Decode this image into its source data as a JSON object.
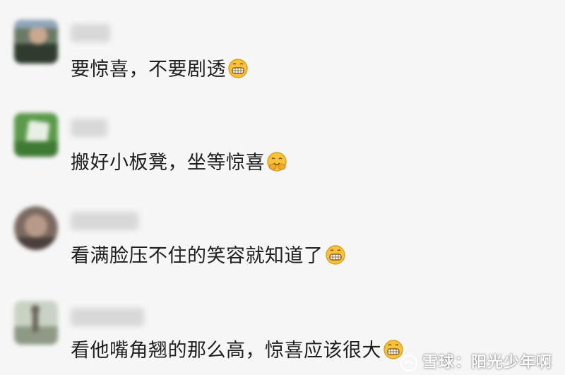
{
  "comments": [
    {
      "text": "要惊喜，不要剧透",
      "emoji": "grinning-emoji"
    },
    {
      "text": "搬好小板凳，坐等惊喜",
      "emoji": "hug-emoji"
    },
    {
      "text": "看满脸压不住的笑容就知道了",
      "emoji": "grinning-emoji"
    },
    {
      "text": "看他嘴角翘的那么高，惊喜应该很大",
      "emoji": "grinning-emoji"
    }
  ],
  "watermark": {
    "text": "雪球：阳光少年啊"
  },
  "colors": {
    "background": "#f6f6f6",
    "text": "#1e1e1e",
    "emoji": "#f7c13a"
  }
}
